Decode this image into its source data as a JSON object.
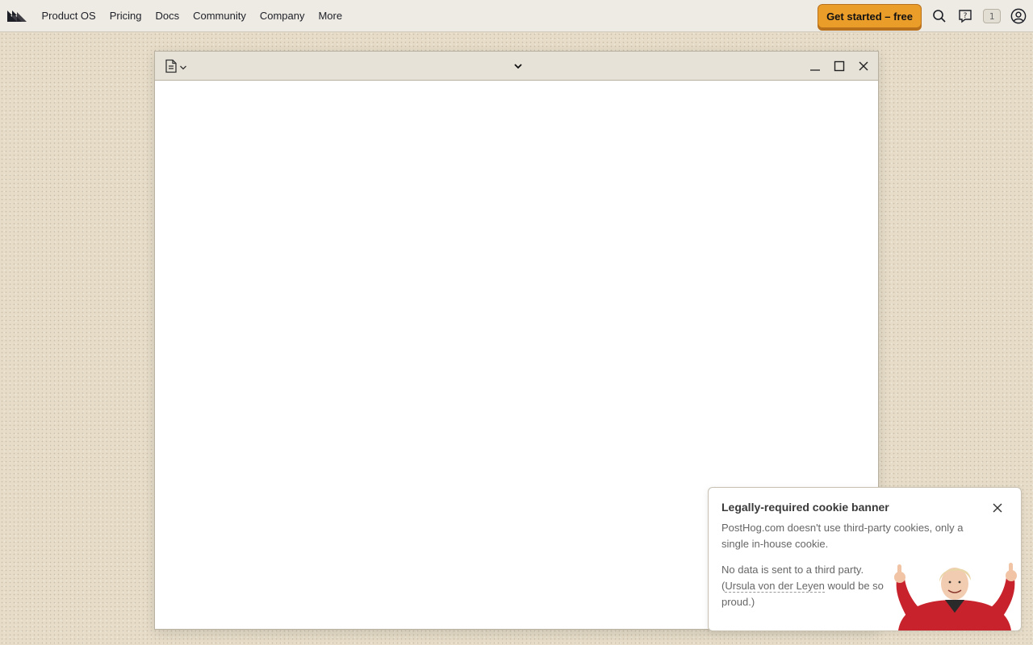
{
  "topbar": {
    "nav": [
      "Product OS",
      "Pricing",
      "Docs",
      "Community",
      "Company",
      "More"
    ],
    "cta_label": "Get started – free",
    "notification_count": "1",
    "icons": [
      "posthog-logo-icon",
      "search-icon",
      "help-icon",
      "avatar-icon"
    ]
  },
  "window": {
    "icons": [
      "document-icon",
      "chevron-down-icon",
      "minimize-icon",
      "maximize-icon",
      "close-icon"
    ]
  },
  "cookie_banner": {
    "title": "Legally-required cookie banner",
    "body1": "PostHog.com doesn't use third-party cookies, only a single in-house cookie.",
    "body2_prefix": "No data is sent to a third party. (",
    "body2_link": "Ursula von der Leyen",
    "body2_suffix": " would be so proud.)"
  },
  "colors": {
    "accent": "#eb9d2a",
    "background": "#e6dcc8",
    "topbar": "#eeebe4"
  }
}
